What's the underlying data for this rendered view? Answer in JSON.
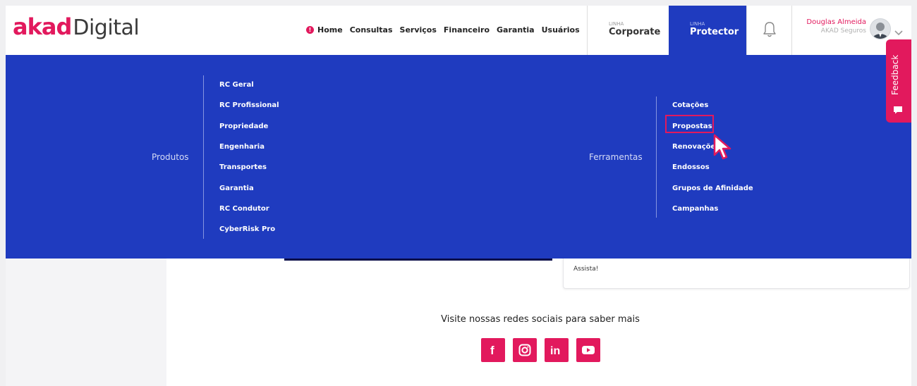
{
  "brand": {
    "akad": "akad",
    "digital": "Digital"
  },
  "topnav": {
    "items": [
      "Home",
      "Consultas",
      "Serviços",
      "Financeiro",
      "Garantia",
      "Usuários"
    ]
  },
  "lines": {
    "corporate": {
      "prefix": "LINHA",
      "name": "Corporate"
    },
    "protector": {
      "prefix": "LINHA",
      "name": "Protector",
      "active": true
    }
  },
  "user": {
    "name": "Douglas Almeida",
    "company": "AKAD Seguros"
  },
  "feedback": {
    "label": "Feedback"
  },
  "menu": {
    "produtos": {
      "label": "Produtos",
      "items": [
        "RC Geral",
        "RC Profissional",
        "Propriedade",
        "Engenharia",
        "Transportes",
        "Garantia",
        "RC Condutor",
        "CyberRisk Pro"
      ]
    },
    "ferramentas": {
      "label": "Ferramentas",
      "items": [
        "Cotações",
        "Propostas",
        "Renovações",
        "Endossos",
        "Grupos de Afinidade",
        "Campanhas"
      ],
      "highlighted": "Propostas"
    }
  },
  "card": {
    "text_visible": "Assista!"
  },
  "social": {
    "title": "Visite nossas redes sociais para saber mais",
    "networks": [
      "facebook",
      "instagram",
      "linkedin",
      "youtube"
    ]
  },
  "colors": {
    "brand_pink": "#e2195d",
    "menu_blue": "#1f3bbf"
  }
}
